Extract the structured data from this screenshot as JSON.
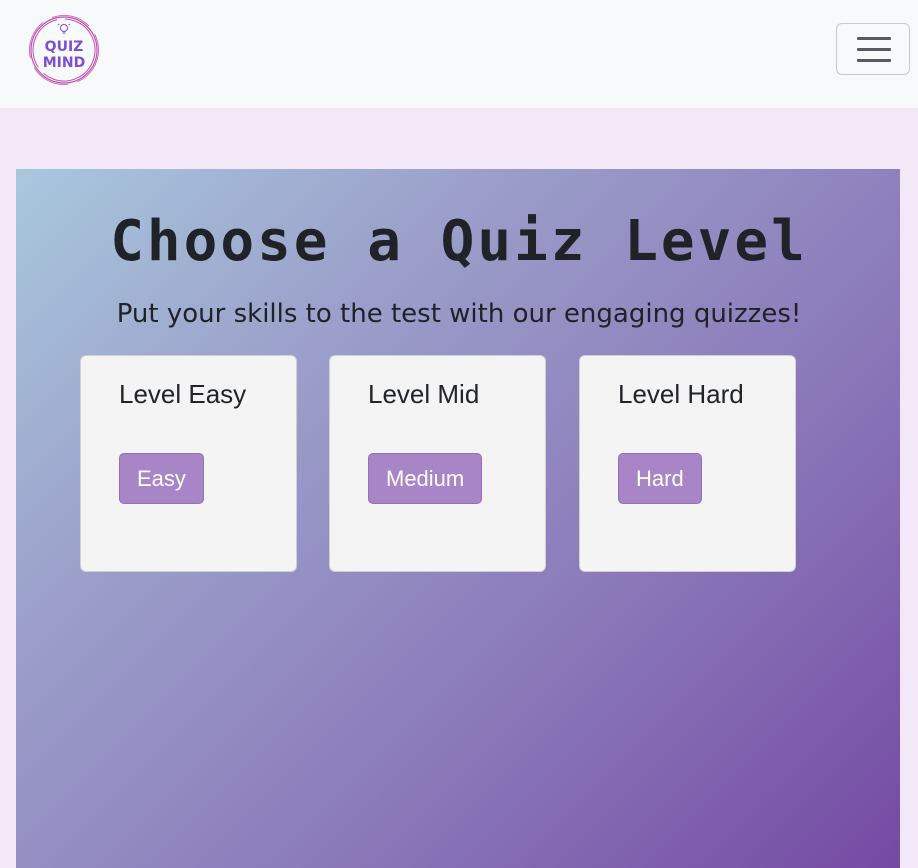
{
  "navbar": {
    "logo_text_line1": "QUIZ",
    "logo_text_line2": "MIND",
    "logo_icon": "lightbulb-icon",
    "menu_icon": "hamburger-menu-icon"
  },
  "hero": {
    "title": "Choose a Quiz Level",
    "subtitle": "Put your skills to the test with our engaging quizzes!"
  },
  "levels": [
    {
      "title": "Level Easy",
      "button_label": "Easy"
    },
    {
      "title": "Level Mid",
      "button_label": "Medium"
    },
    {
      "title": "Level Hard",
      "button_label": "Hard"
    }
  ],
  "colors": {
    "brand": "#7b4fd1",
    "button": "#a785c7",
    "gradient_start": "#a8c8dd",
    "gradient_end": "#744aa3"
  }
}
